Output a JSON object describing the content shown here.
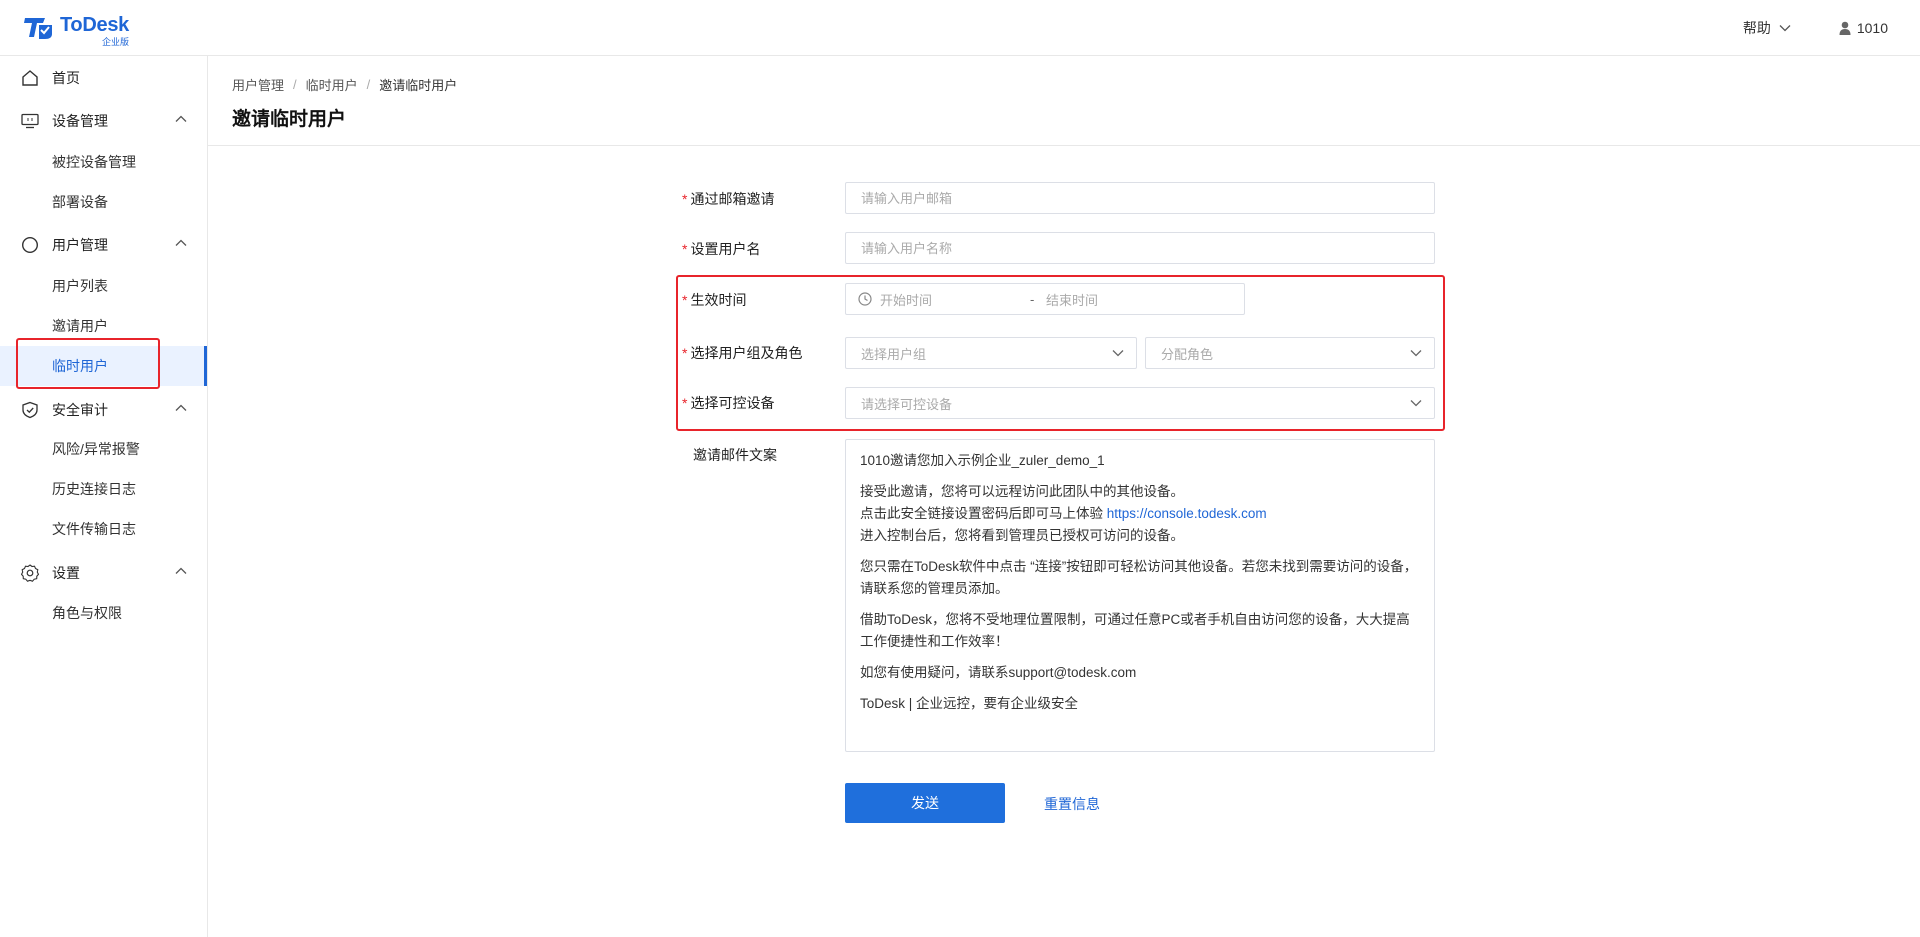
{
  "header": {
    "logo_name": "ToDesk",
    "logo_sub": "企业版",
    "help_label": "帮助",
    "user_name": "1010"
  },
  "sidebar": {
    "home": "首页",
    "device_mgmt": "设备管理",
    "controlled_devices": "被控设备管理",
    "deploy_devices": "部署设备",
    "user_mgmt": "用户管理",
    "user_list": "用户列表",
    "invite_user": "邀请用户",
    "temp_user": "临时用户",
    "security_audit": "安全审计",
    "risk_alerts": "风险/异常报警",
    "history_logs": "历史连接日志",
    "file_logs": "文件传输日志",
    "settings": "设置",
    "roles": "角色与权限"
  },
  "breadcrumb": {
    "item1": "用户管理",
    "item2": "临时用户",
    "item3": "邀请临时用户",
    "separator": "/"
  },
  "page": {
    "title": "邀请临时用户"
  },
  "form": {
    "required_mark": "*",
    "email_label": "通过邮箱邀请",
    "email_placeholder": "请输入用户邮箱",
    "username_label": "设置用户名",
    "username_placeholder": "请输入用户名称",
    "time_label": "生效时间",
    "start_placeholder": "开始时间",
    "range_dash": "-",
    "end_placeholder": "结束时间",
    "group_role_label": "选择用户组及角色",
    "group_placeholder": "选择用户组",
    "role_placeholder": "分配角色",
    "device_label": "选择可控设备",
    "device_placeholder": "请选择可控设备",
    "mail_label": "邀请邮件文案",
    "mail": {
      "line1": "1010邀请您加入示例企业_zuler_demo_1",
      "p2_a": "接受此邀请，您将可以远程访问此团队中的其他设备。",
      "p2_b": "点击此安全链接设置密码后即可马上体验 ",
      "p2_link": "https://console.todesk.com",
      "p2_c": "进入控制台后，您将看到管理员已授权可访问的设备。",
      "p3": "您只需在ToDesk软件中点击 “连接”按钮即可轻松访问其他设备。若您未找到需要访问的设备，请联系您的管理员添加。",
      "p4": "借助ToDesk，您将不受地理位置限制，可通过任意PC或者手机自由访问您的设备，大大提高工作便捷性和工作效率！",
      "p5": "如您有使用疑问，请联系support@todesk.com",
      "p6": "ToDesk | 企业远控，要有企业级安全"
    },
    "send_label": "发送",
    "reset_label": "重置信息"
  },
  "colors": {
    "brand": "#1f66d6",
    "primary_button": "#1f6fdc",
    "required": "#e8242b",
    "annotation": "#e8242b",
    "active_bg": "#eaf2ff"
  },
  "icons": {
    "home": "home-icon",
    "device": "monitor-icon",
    "user": "user-circle-icon",
    "security": "shield-check-icon",
    "settings": "gear-icon",
    "clock": "clock-icon",
    "chevron": "chevron-down-icon"
  }
}
